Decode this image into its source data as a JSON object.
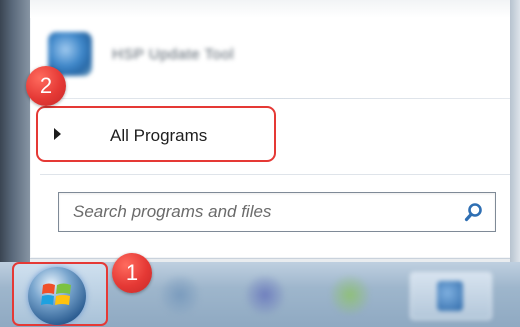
{
  "start_menu": {
    "blurred_program": {
      "label": "HSP Update Tool",
      "icon": "program-icon"
    },
    "all_programs": {
      "label": "All Programs",
      "arrow_icon": "right-arrow-icon"
    },
    "search": {
      "placeholder": "Search programs and files",
      "icon": "search-icon"
    }
  },
  "annotations": {
    "step1": "1",
    "step2": "2",
    "highlight_color": "#e53935"
  },
  "taskbar": {
    "start_button_icon": "windows-logo-icon"
  }
}
